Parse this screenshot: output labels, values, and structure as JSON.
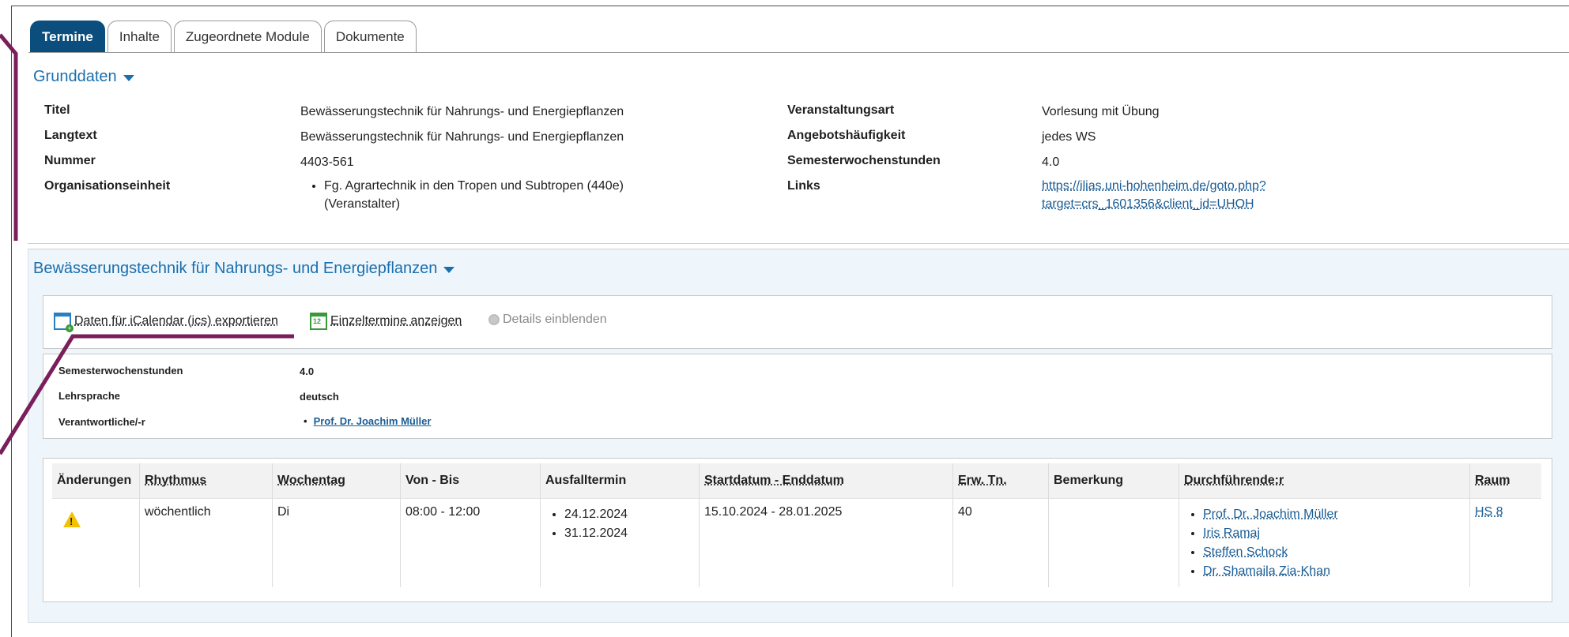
{
  "tabs": [
    "Termine",
    "Inhalte",
    "Zugeordnete Module",
    "Dokumente"
  ],
  "grunddaten": {
    "title": "Grunddaten",
    "left": [
      {
        "label": "Titel",
        "value": "Bewässerungstechnik für Nahrungs- und Energiepflanzen"
      },
      {
        "label": "Langtext",
        "value": "Bewässerungstechnik für Nahrungs- und Energiepflanzen"
      },
      {
        "label": "Nummer",
        "value": "4403-561"
      },
      {
        "label": "Organisationseinheit",
        "value": "Fg. Agrartechnik in den Tropen und Subtropen (440e)",
        "value2": "(Veranstalter)"
      }
    ],
    "right": [
      {
        "label": "Veranstaltungsart",
        "value": "Vorlesung mit Übung"
      },
      {
        "label": "Angebotshäufigkeit",
        "value": "jedes WS"
      },
      {
        "label": "Semesterwochenstunden",
        "value": "4.0"
      },
      {
        "label": "Links",
        "value": "https://ilias.uni-hohenheim.de/goto.php?",
        "value2": "target=crs_1601356&client_id=UHOH"
      }
    ]
  },
  "course": {
    "title": "Bewässerungstechnik für Nahrungs- und Energiepflanzen",
    "toolbar": {
      "export": "Daten für iCalendar (ics) exportieren",
      "einzeltermine": "Einzeltermine anzeigen",
      "details": "Details einblenden"
    },
    "info": [
      {
        "label": "Semesterwochenstunden",
        "value": "4.0"
      },
      {
        "label": "Lehrsprache",
        "value": "deutsch"
      },
      {
        "label": "Verantwortliche/-r",
        "value": "Prof. Dr. Joachim Müller"
      }
    ],
    "table": {
      "headers": [
        "Änderungen",
        "Rhythmus",
        "Wochentag",
        "Von - Bis",
        "Ausfalltermin",
        "Startdatum - Enddatum",
        "Erw. Tn.",
        "Bemerkung",
        "Durchführende:r",
        "Raum"
      ],
      "row": {
        "rhythmus": "wöchentlich",
        "wochentag": "Di",
        "zeit": "08:00 - 12:00",
        "ausfall": [
          "24.12.2024",
          "31.12.2024"
        ],
        "datum": "15.10.2024 - 28.01.2025",
        "erw": "40",
        "bemerkung": "",
        "personen": [
          "Prof. Dr. Joachim Müller",
          "Iris Ramaj",
          "Steffen Schock",
          "Dr. Shamaila Zia-Khan"
        ],
        "raum": "HS 8"
      }
    }
  },
  "colors": {
    "accent": "#1a6fae",
    "tab_active": "#0b4d7c",
    "annotation": "#7a1f5c"
  },
  "icons": [
    "calendar-export-icon",
    "calendar-icon",
    "magnifier-icon",
    "warning-icon",
    "caret-down-icon"
  ]
}
